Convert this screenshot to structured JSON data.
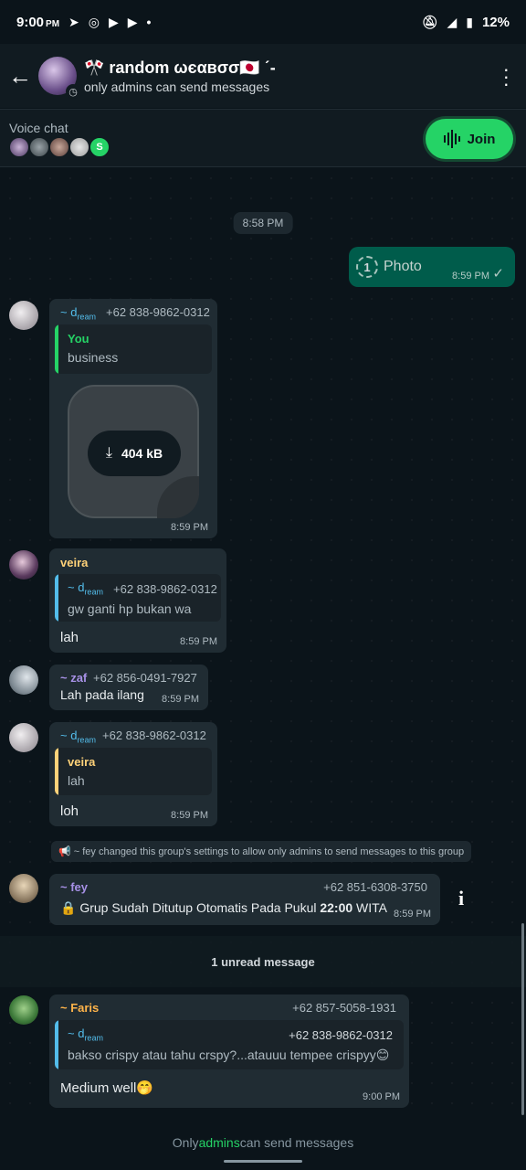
{
  "status_bar": {
    "time": "9:00",
    "time_suffix": "PM",
    "battery": "12%"
  },
  "header": {
    "title": "🎌 random ωєαвσσ🇯🇵 ˊ-",
    "subtitle": "only admins can send messages"
  },
  "voice_chat": {
    "label": "Voice chat",
    "extra_avatar_letter": "S",
    "join_label": "Join"
  },
  "chat": {
    "time_chip": "8:58 PM",
    "outgoing_photo": {
      "label": "Photo",
      "count": "1",
      "time": "8:59 PM"
    },
    "msg1": {
      "sender_prefix": "~ d",
      "sender_sub": "ream",
      "phone": "+62 838-9862-0312",
      "quote_name": "You",
      "quote_text": "business",
      "file_size": "404 kB",
      "time": "8:59 PM"
    },
    "msg2": {
      "sender": "veira",
      "quote_name_prefix": "~ d",
      "quote_name_sub": "ream",
      "quote_phone": "+62 838-9862-0312",
      "quote_text": "gw ganti hp bukan wa",
      "text": "lah",
      "time": "8:59 PM"
    },
    "msg3": {
      "sender": "~ zaf",
      "phone": "+62 856-0491-7927",
      "text": "Lah pada ilang",
      "time": "8:59 PM"
    },
    "msg4": {
      "sender_prefix": "~ d",
      "sender_sub": "ream",
      "phone": "+62 838-9862-0312",
      "quote_name": "veira",
      "quote_text": "lah",
      "text": "loh",
      "time": "8:59 PM"
    },
    "system_message": "📢 ~ fey changed this group's settings to allow only admins to send messages to this group",
    "msg5": {
      "sender": "~ fey",
      "phone": "+62 851-6308-3750",
      "text_before": "🔒 Grup Sudah Ditutup Otomatis Pada Pukul ",
      "text_bold": "22:00",
      "text_after": " WITA",
      "time": "8:59 PM"
    },
    "unread_label": "1 unread message",
    "msg6": {
      "sender": "~ Faris",
      "phone": "+62 857-5058-1931",
      "quote_name_prefix": "~ d",
      "quote_name_sub": "ream",
      "quote_phone": "+62 838-9862-0312",
      "quote_text": "bakso crispy atau tahu crspy?...atauuu tempee crispyy😊",
      "text": "Medium well🤭",
      "time": "9:00 PM"
    }
  },
  "footer": {
    "prefix": "Only ",
    "admins": "admins",
    "suffix": " can send messages"
  },
  "colors": {
    "accent": "#25d366",
    "chat_bg": "#0b141a",
    "incoming_bubble": "#202c33",
    "outgoing_bubble": "#005c4b"
  }
}
